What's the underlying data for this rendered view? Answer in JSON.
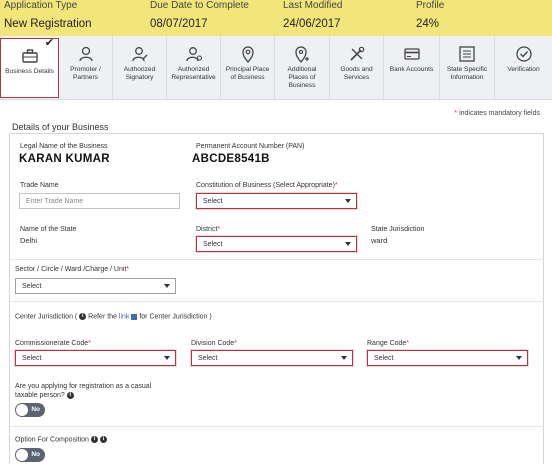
{
  "info_bar": {
    "application_type_label": "Application Type",
    "application_type_value": "New Registration",
    "due_date_label": "Due Date to Complete",
    "due_date_value": "08/07/2017",
    "last_modified_label": "Last Modified",
    "last_modified_value": "24/06/2017",
    "profile_label": "Profile",
    "profile_value": "24%"
  },
  "tabs": [
    {
      "label": "Business Details",
      "icon": "briefcase-icon",
      "active": true,
      "completed": true
    },
    {
      "label": "Promoter / Partners",
      "icon": "user-icon"
    },
    {
      "label": "Authorized Signatory",
      "icon": "user-edit-icon"
    },
    {
      "label": "Authorized Representative",
      "icon": "user-rep-icon"
    },
    {
      "label": "Principal Place of Business",
      "icon": "location-pin-icon"
    },
    {
      "label": "Additional Places of Business",
      "icon": "location-plus-icon"
    },
    {
      "label": "Goods and Services",
      "icon": "tools-icon"
    },
    {
      "label": "Bank Accounts",
      "icon": "bank-icon"
    },
    {
      "label": "State Specific Information",
      "icon": "list-icon"
    },
    {
      "label": "Verification",
      "icon": "check-circle-icon"
    }
  ],
  "mandatory_note": "indicates mandatory fields",
  "section_title": "Details of your Business",
  "form": {
    "legal_name_label": "Legal Name of the Business",
    "legal_name_value": "KARAN KUMAR",
    "pan_label": "Permanent Account Number (PAN)",
    "pan_value": "ABCDE8541B",
    "trade_name_label": "Trade Name",
    "trade_name_placeholder": "Enter Trade Name",
    "constitution_label": "Constitution of Business (Select Appropriate)",
    "constitution_value": "Select",
    "state_label": "Name of the State",
    "state_value": "Delhi",
    "district_label": "District",
    "district_value": "Select",
    "state_jurisdiction_label": "State Jurisdiction",
    "state_jurisdiction_value": "ward",
    "sector_label": "Sector / Circle / Ward /Charge / Unit",
    "sector_value": "Select",
    "center_jurisdiction_prefix": "Center Jurisdiction (",
    "center_jurisdiction_refer": "Refer the",
    "center_jurisdiction_link": "link",
    "center_jurisdiction_suffix": "for Center Jurisdiction )",
    "commissionerate_label": "Commissionerate Code",
    "commissionerate_value": "Select",
    "division_label": "Division Code",
    "division_value": "Select",
    "range_label": "Range Code",
    "range_value": "Select",
    "casual_label_line1": "Are you applying for registration as a casual",
    "casual_label_line2": "taxable person?",
    "casual_toggle": "No",
    "composition_label": "Option For Composition",
    "composition_toggle": "No"
  },
  "colors": {
    "info_bar_bg": "#f2e67a",
    "active_border": "#b2343f",
    "required_star": "#c0392b",
    "link": "#3a6fb0"
  }
}
